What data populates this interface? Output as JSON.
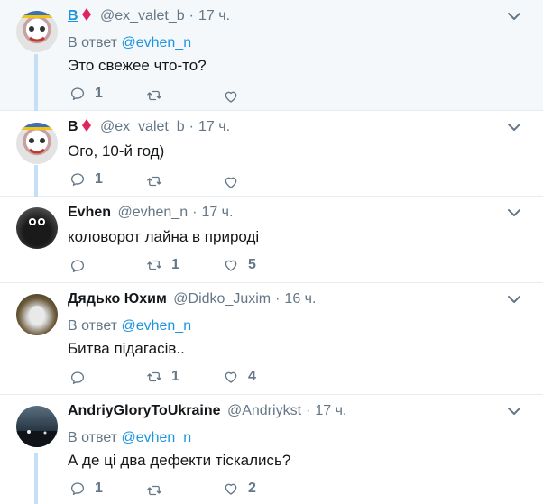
{
  "tweets": [
    {
      "name": "В",
      "handle": "@ex_valet_b",
      "time": "17 ч.",
      "reply_prefix": "В ответ",
      "reply_to": "@evhen_n",
      "text": "Это свежее что-то?",
      "replies": "1",
      "retweets": "",
      "likes": ""
    },
    {
      "name": "В",
      "handle": "@ex_valet_b",
      "time": "17 ч.",
      "reply_prefix": "",
      "reply_to": "",
      "text": "Ого, 10-й год)",
      "replies": "1",
      "retweets": "",
      "likes": ""
    },
    {
      "name": "Evhen",
      "handle": "@evhen_n",
      "time": "17 ч.",
      "reply_prefix": "",
      "reply_to": "",
      "text": "коловорот лайна в природі",
      "replies": "",
      "retweets": "1",
      "likes": "5"
    },
    {
      "name": "Дядько Юхим",
      "handle": "@Didko_Juxim",
      "time": "16 ч.",
      "reply_prefix": "В ответ",
      "reply_to": "@evhen_n",
      "text": "Битва підагасів..",
      "replies": "",
      "retweets": "1",
      "likes": "4"
    },
    {
      "name": "AndriyGloryToUkraine",
      "handle": "@Andriykst",
      "time": "17 ч.",
      "reply_prefix": "В ответ",
      "reply_to": "@evhen_n",
      "text": "А де ці два дефекти тіскались?",
      "replies": "1",
      "retweets": "",
      "likes": "2"
    }
  ],
  "icons": {
    "reply": "reply-icon",
    "retweet": "retweet-icon",
    "like": "heart-icon",
    "more": "chevron-down-icon"
  },
  "colors": {
    "link": "#1b95e0",
    "muted": "#657786",
    "thread": "#c4dff6",
    "highlight": "#f5f8fa"
  }
}
